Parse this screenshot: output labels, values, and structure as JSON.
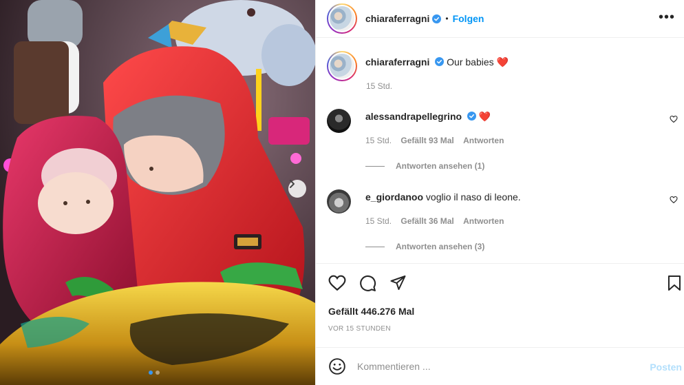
{
  "header": {
    "username": "chiaraferragni",
    "separator": "•",
    "follow_label": "Folgen",
    "more_icon": "more-horizontal-icon"
  },
  "caption": {
    "username": "chiaraferragni",
    "text": "Our babies",
    "emoji": "❤️",
    "time": "15 Std."
  },
  "comments": [
    {
      "username": "alessandrapellegrino",
      "text": "",
      "emoji": "❤️",
      "time": "15 Std.",
      "likes": "Gefällt 93 Mal",
      "reply": "Antworten",
      "view_replies": "Antworten ansehen (1)",
      "verified": true
    },
    {
      "username": "e_giordanoo",
      "text": "voglio il naso di leone.",
      "time": "15 Std.",
      "likes": "Gefällt 36 Mal",
      "reply": "Antworten",
      "view_replies": "Antworten ansehen (3)",
      "verified": false
    }
  ],
  "stats": {
    "likes": "Gefällt 446.276 Mal",
    "posted": "VOR 15 STUNDEN"
  },
  "composer": {
    "placeholder": "Kommentieren ...",
    "post_label": "Posten"
  },
  "carousel": {
    "current": 1,
    "total": 2
  },
  "colors": {
    "accent": "#0095f6",
    "verified": "#3897f0",
    "heart": "#ed4956",
    "post_disabled": "#b2dffc"
  }
}
